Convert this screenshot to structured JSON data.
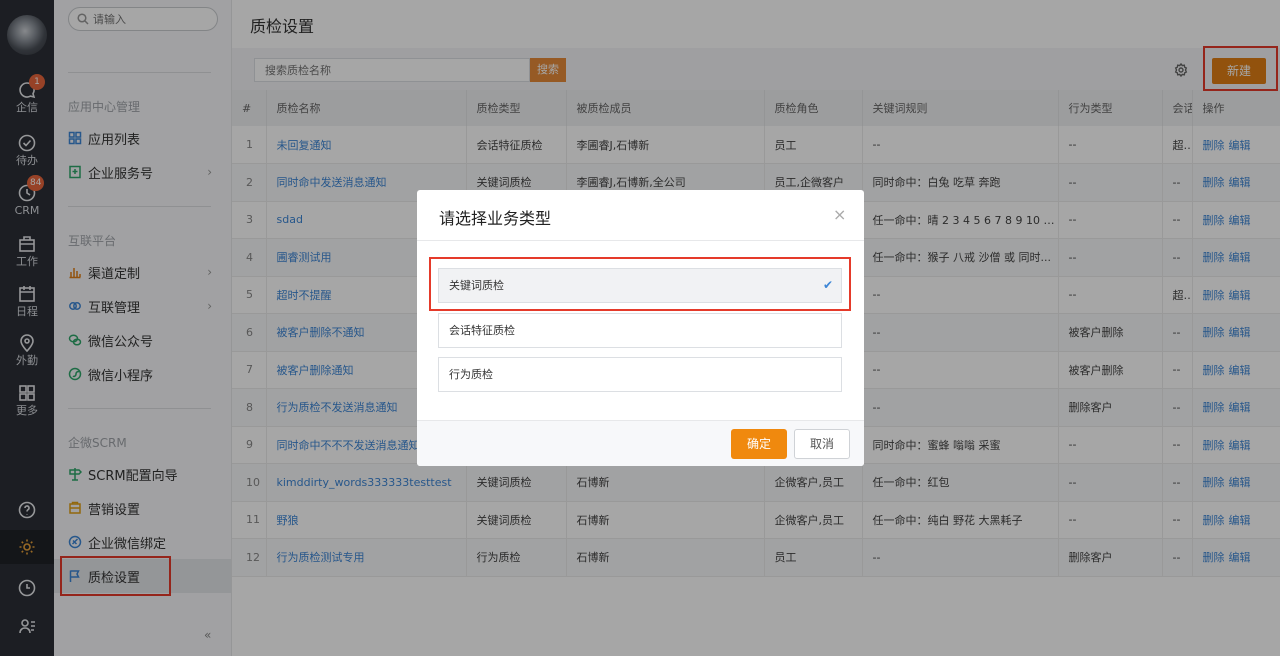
{
  "rail": {
    "items": [
      {
        "label": "企信",
        "badge": "1"
      },
      {
        "label": "待办"
      },
      {
        "label": "CRM",
        "badge": "84"
      },
      {
        "label": "工作"
      },
      {
        "label": "日程"
      },
      {
        "label": "外勤"
      },
      {
        "label": "更多"
      }
    ]
  },
  "menu": {
    "search_placeholder": "请输入",
    "sections": [
      {
        "title": "应用中心管理",
        "items": [
          {
            "label": "应用列表"
          },
          {
            "label": "企业服务号"
          }
        ]
      },
      {
        "title": "互联平台",
        "items": [
          {
            "label": "渠道定制"
          },
          {
            "label": "互联管理"
          },
          {
            "label": "微信公众号"
          },
          {
            "label": "微信小程序"
          }
        ]
      },
      {
        "title": "企微SCRM",
        "items": [
          {
            "label": "SCRM配置向导"
          },
          {
            "label": "营销设置"
          },
          {
            "label": "企业微信绑定"
          },
          {
            "label": "质检设置"
          }
        ]
      }
    ],
    "collapse": "«"
  },
  "page": {
    "title": "质检设置",
    "search_placeholder": "搜索质检名称",
    "search_button": "搜索",
    "new_button": "新建"
  },
  "table": {
    "columns": [
      "#",
      "质检名称",
      "质检类型",
      "被质检成员",
      "质检角色",
      "关键词规则",
      "行为类型",
      "会话",
      "操作"
    ],
    "rows": [
      [
        "1",
        "未回复通知",
        "会话特征质检",
        "李圃睿J,石博新",
        "员工",
        "--",
        "--",
        "超时"
      ],
      [
        "2",
        "同时命中发送消息通知",
        "关键词质检",
        "李圃睿J,石博新,全公司",
        "员工,企微客户",
        "同时命中：白兔 吃草 奔跑",
        "--",
        "--"
      ],
      [
        "3",
        "sdad",
        "",
        "",
        "",
        "任一命中：晴 2 3 4 5 6 7 8 9 10 11 ...",
        "--",
        "--"
      ],
      [
        "4",
        "圃睿测试用",
        "",
        "",
        "",
        "任一命中：猴子 八戒 沙僧 或 同时...",
        "--",
        "--"
      ],
      [
        "5",
        "超时不提醒",
        "",
        "",
        "",
        "--",
        "--",
        "超时"
      ],
      [
        "6",
        "被客户删除不通知",
        "",
        "",
        "",
        "--",
        "被客户删除",
        "--"
      ],
      [
        "7",
        "被客户删除通知",
        "",
        "",
        "",
        "--",
        "被客户删除",
        "--"
      ],
      [
        "8",
        "行为质检不发送消息通知",
        "",
        "",
        "",
        "--",
        "删除客户",
        "--"
      ],
      [
        "9",
        "同时命中不不不发送消息通知",
        "",
        "",
        "",
        "同时命中：蜜蜂 嗡嗡 采蜜",
        "--",
        "--"
      ],
      [
        "10",
        "kimddirty_words333333testtest",
        "关键词质检",
        "石博新",
        "企微客户,员工",
        "任一命中：红包",
        "--",
        "--"
      ],
      [
        "11",
        "野狼",
        "关键词质检",
        "石博新",
        "企微客户,员工",
        "任一命中：纯白 野花 大黑耗子",
        "--",
        "--"
      ],
      [
        "12",
        "行为质检测试专用",
        "行为质检",
        "石博新",
        "员工",
        "--",
        "删除客户",
        "--"
      ]
    ],
    "op_delete": "删除",
    "op_edit": "编辑"
  },
  "modal": {
    "title": "请选择业务类型",
    "close": "×",
    "options": [
      {
        "label": "关键词质检",
        "selected": true
      },
      {
        "label": "会话特征质检",
        "selected": false
      },
      {
        "label": "行为质检",
        "selected": false
      }
    ],
    "check_mark": "✔",
    "ok": "确定",
    "cancel": "取消"
  }
}
